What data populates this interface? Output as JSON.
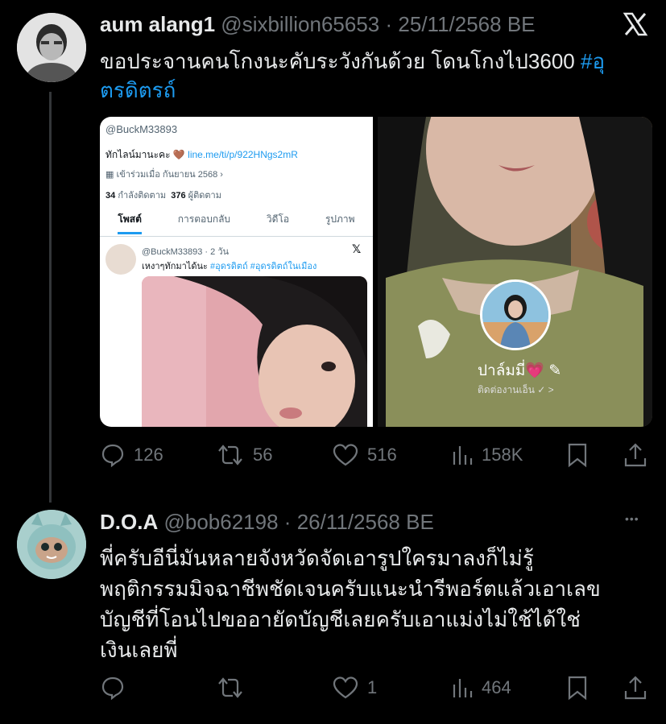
{
  "tweet1": {
    "display_name": "aum alang1",
    "handle": "@sixbillion65653",
    "separator": "·",
    "date": "25/11/2568 BE",
    "text_line1": "ขอประจานคนโกงนะคับระวังกันด้วย โดนโกงไป3600 ",
    "hashtag_part1": "#อุ",
    "hashtag_part2": "ตรดิตรถ์",
    "left_image": {
      "profile_handle": "@BuckM33893",
      "bio_text": "ทักไลน์มานะคะ 🤎",
      "bio_link": "line.me/ti/p/922HNgs2mR",
      "joined": "เข้าร่วมเมื่อ กันยายน 2568",
      "following_count": "34",
      "following_label": "กำลังติดตาม",
      "followers_count": "376",
      "followers_label": "ผู้ติดตาม",
      "tabs": [
        "โพสต์",
        "การตอบกลับ",
        "วิดีโอ",
        "รูปภาพ"
      ],
      "inner_post_handle": "@BuckM33893 · 2 วัน",
      "inner_post_text": "เหงาๆทักมาได้นะ ",
      "inner_post_tags": "#อุดรดิตถ์ #อุดรดิตถ์ในเมือง"
    },
    "right_image": {
      "story_name": "ปาล์มมี่💗",
      "story_sub": "ติดต่องานเอ็น ✓ >"
    },
    "actions": {
      "replies": "126",
      "reposts": "56",
      "likes": "516",
      "views": "158K"
    }
  },
  "tweet2": {
    "display_name": "D.O.A",
    "handle": "@bob62198",
    "separator": "·",
    "date": "26/11/2568 BE",
    "more": "•••",
    "lines": [
      "พี่ครับอีนี่มันหลายจังหวัดจัดเอารูปใครมาลงก็ไม่รู้",
      "พฤติกรรมมิจฉาชีพชัดเจนครับแนะนำรีพอร์ตแล้วเอาเลข",
      "บัญชีที่โอนไปขออายัดบัญชีเลยครับเอาแม่งไม่ใช้ได้ใช่",
      "เงินเลยพี่"
    ],
    "actions": {
      "replies": "",
      "reposts": "",
      "likes": "1",
      "views": "464"
    }
  },
  "colors": {
    "background": "#000000",
    "text": "#e7e9ea",
    "muted": "#71767b",
    "link": "#1d9bf0"
  }
}
